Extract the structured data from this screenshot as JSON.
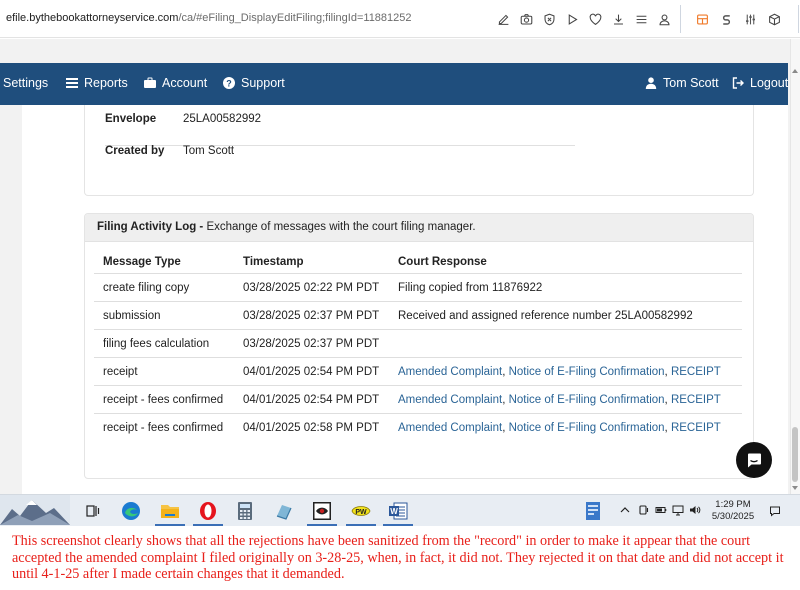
{
  "browser": {
    "url_host": "efile.bythebookattorneyservice.com",
    "url_rest": "/ca/#eFiling_DisplayEditFiling;filingId=11881252",
    "toolbar_icons": [
      "edit-icon",
      "camera-icon",
      "shield-icon",
      "play-icon",
      "heart-icon",
      "download-icon",
      "list-icon",
      "user-icon"
    ],
    "extension_icons": [
      "sidebar-icon",
      "s-extension-icon",
      "sliders-icon",
      "cube-icon"
    ]
  },
  "nav": {
    "items": [
      {
        "label": "Settings",
        "icon": "none"
      },
      {
        "label": "Reports",
        "icon": "list-icon"
      },
      {
        "label": "Account",
        "icon": "briefcase-icon"
      },
      {
        "label": "Support",
        "icon": "question-icon"
      }
    ],
    "user": {
      "label": "Tom Scott",
      "icon": "person-icon"
    },
    "logout": {
      "label": "Logout",
      "icon": "logout-icon"
    }
  },
  "details": [
    {
      "key": "Envelope",
      "value": "25LA00582992"
    },
    {
      "key": "Created by",
      "value": "Tom Scott"
    }
  ],
  "activity_log": {
    "title": "Filing Activity Log -",
    "subtitle": " Exchange of messages with the court filing manager.",
    "columns": [
      "Message Type",
      "Timestamp",
      "Court Response"
    ],
    "rows": [
      {
        "type": "create filing copy",
        "timestamp": "03/28/2025 02:22 PM PDT",
        "response": "Filing copied from 11876922",
        "links": []
      },
      {
        "type": "submission",
        "timestamp": "03/28/2025 02:37 PM PDT",
        "response": "Received and assigned reference number 25LA00582992",
        "links": []
      },
      {
        "type": "filing fees calculation",
        "timestamp": "03/28/2025 02:37 PM PDT",
        "response": "",
        "links": []
      },
      {
        "type": "receipt",
        "timestamp": "04/01/2025 02:54 PM PDT",
        "response": "",
        "links": [
          "Amended Complaint",
          "Notice of E-Filing Confirmation",
          "RECEIPT"
        ]
      },
      {
        "type": "receipt - fees confirmed",
        "timestamp": "04/01/2025 02:54 PM PDT",
        "response": "",
        "links": [
          "Amended Complaint",
          "Notice of E-Filing Confirmation",
          "RECEIPT"
        ]
      },
      {
        "type": "receipt - fees confirmed",
        "timestamp": "04/01/2025 02:58 PM PDT",
        "response": "",
        "links": [
          "Amended Complaint",
          "Notice of E-Filing Confirmation",
          "RECEIPT"
        ]
      }
    ]
  },
  "taskbar": {
    "apps": [
      "mountain-wallpaper-icon",
      "task-view-icon",
      "edge-icon",
      "file-explorer-icon",
      "opera-icon",
      "calculator-icon",
      "app-icon",
      "eye-app-icon",
      "pw-app-icon",
      "word-icon"
    ],
    "tray_icons": [
      "chevron-up-icon",
      "device-icon",
      "battery-icon",
      "network-icon",
      "volume-icon",
      "notifications-icon"
    ],
    "time": "1:29 PM",
    "date": "5/30/2025"
  },
  "annotation": "This screenshot clearly shows that all the rejections have been sanitized from the \"record\" in order to make it appear that the court accepted the amended complaint I filed originally on 3-28-25, when, in fact, it did not.  They rejected it on that date and did not accept it until 4-1-25 after I made certain changes that it demanded.",
  "colors": {
    "navbar": "#1f4e7d",
    "link": "#2a6496",
    "annotation": "#e8201a"
  }
}
